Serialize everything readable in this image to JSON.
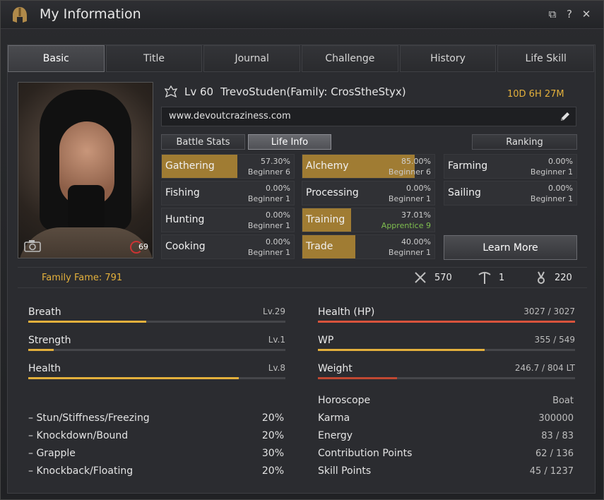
{
  "window": {
    "title": "My Information"
  },
  "tabs": [
    "Basic",
    "Title",
    "Journal",
    "Challenge",
    "History",
    "Life Skill"
  ],
  "character": {
    "level": "Lv 60",
    "name": "TrevoStuden(Family: CrosStheStyx)",
    "playtime": "10D 6H 27M",
    "url": "www.devoutcraziness.com",
    "portrait_level": "69"
  },
  "buttons": {
    "battle_stats": "Battle Stats",
    "life_info": "Life Info",
    "ranking": "Ranking",
    "learn_more": "Learn More"
  },
  "life_skills": [
    {
      "name": "Gathering",
      "pct": "57.30%",
      "grade": "Beginner 6",
      "progress": 0.573
    },
    {
      "name": "Alchemy",
      "pct": "85.00%",
      "grade": "Beginner 6",
      "progress": 0.85
    },
    {
      "name": "Farming",
      "pct": "0.00%",
      "grade": "Beginner 1",
      "progress": 0
    },
    {
      "name": "Fishing",
      "pct": "0.00%",
      "grade": "Beginner 1",
      "progress": 0
    },
    {
      "name": "Processing",
      "pct": "0.00%",
      "grade": "Beginner 1",
      "progress": 0
    },
    {
      "name": "Sailing",
      "pct": "0.00%",
      "grade": "Beginner 1",
      "progress": 0
    },
    {
      "name": "Hunting",
      "pct": "0.00%",
      "grade": "Beginner 1",
      "progress": 0
    },
    {
      "name": "Training",
      "pct": "37.01%",
      "grade": "Apprentice 9",
      "progress": 0.3701
    },
    {
      "name": "Cooking",
      "pct": "0.00%",
      "grade": "Beginner 1",
      "progress": 0
    },
    {
      "name": "Trade",
      "pct": "40.00%",
      "grade": "Beginner 1",
      "progress": 0.4
    }
  ],
  "family": {
    "fame": "Family Fame: 791",
    "combat": "570",
    "life": "1",
    "skill": "220"
  },
  "stats_left": [
    {
      "label": "Breath",
      "value": "Lv.29",
      "progress": 0.46,
      "color": "#e3b03c"
    },
    {
      "label": "Strength",
      "value": "Lv.1",
      "progress": 0.1,
      "color": "#e3b03c"
    },
    {
      "label": "Health",
      "value": "Lv.8",
      "progress": 0.82,
      "color": "#e3b03c"
    }
  ],
  "stats_right": [
    {
      "label": "Health (HP)",
      "value": "3027 / 3027",
      "progress": 1.0,
      "color": "#d9533c"
    },
    {
      "label": "WP",
      "value": "355 / 549",
      "progress": 0.647,
      "color": "#e3b03c"
    },
    {
      "label": "Weight",
      "value": "246.7 / 804 LT",
      "progress": 0.307,
      "color": "#c14832"
    }
  ],
  "resistances": [
    {
      "label": "– Stun/Stiffness/Freezing",
      "value": "20%"
    },
    {
      "label": "– Knockdown/Bound",
      "value": "20%"
    },
    {
      "label": "– Grapple",
      "value": "30%"
    },
    {
      "label": "– Knockback/Floating",
      "value": "20%"
    }
  ],
  "info": [
    {
      "label": "Horoscope",
      "value": "Boat"
    },
    {
      "label": "Karma",
      "value": "300000"
    },
    {
      "label": "Energy",
      "value": "83 / 83"
    },
    {
      "label": "Contribution Points",
      "value": "62 / 136"
    },
    {
      "label": "Skill Points",
      "value": "45 / 1237"
    }
  ]
}
